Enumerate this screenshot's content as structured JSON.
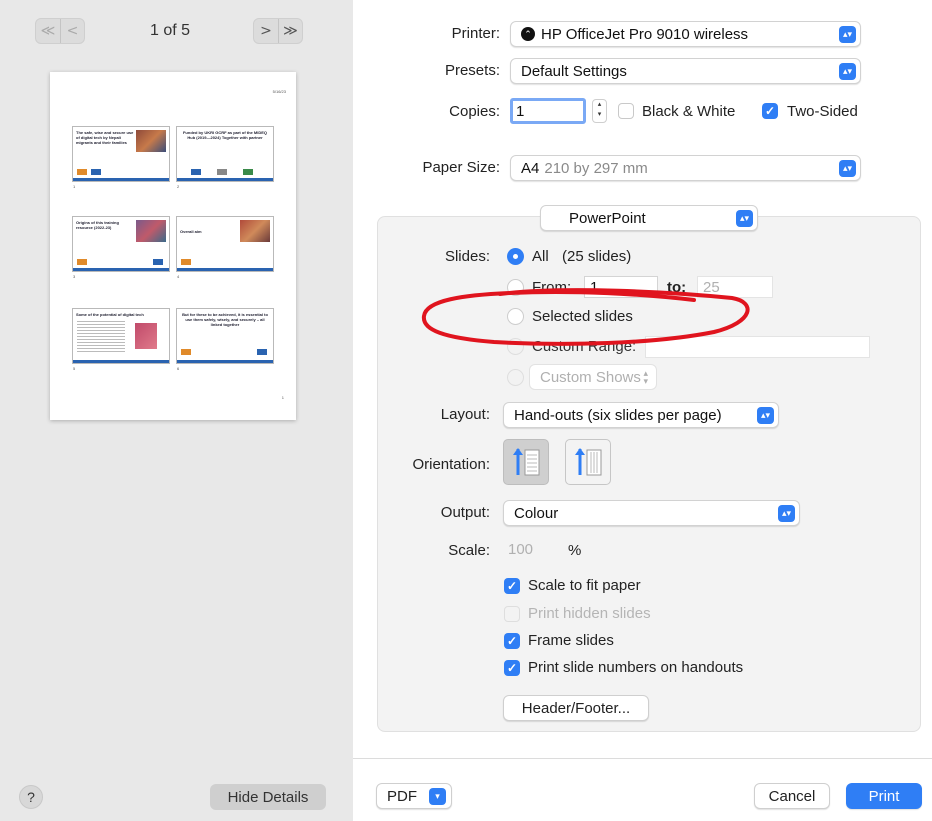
{
  "preview": {
    "page_indicator": "1 of 5",
    "nav_first_glyph": "≪",
    "nav_prev_glyph": "<",
    "nav_next_glyph": ">",
    "nav_last_glyph": "≫",
    "thumb_date": "5/16/23",
    "thumb_page_number": "1",
    "slides": [
      {
        "title": "The safe, wise and secure use of digital tech by Nepali migrants and their families",
        "number": "1"
      },
      {
        "title": "Funded by UKRI GCRF as part of the MIDEQ Hub (2019—2024) Together with partner",
        "number": "2"
      },
      {
        "title": "Origins of this training resource (2022-23)",
        "number": "3"
      },
      {
        "title": "Overall aim",
        "number": "4"
      },
      {
        "title": "Some of the potential of digital tech",
        "number": "5"
      },
      {
        "title": "But for these to be achieved, it is essential to use them safely, wisely, and securely – all linked together",
        "number": "6"
      }
    ]
  },
  "footer_left": {
    "help_label": "?",
    "hide_details_label": "Hide Details"
  },
  "printer": {
    "label": "Printer:",
    "value": "HP OfficeJet Pro 9010 wireless"
  },
  "presets": {
    "label": "Presets:",
    "value": "Default Settings"
  },
  "copies": {
    "label": "Copies:",
    "value": "1",
    "black_white_label": "Black & White",
    "black_white_checked": false,
    "two_sided_label": "Two-Sided",
    "two_sided_checked": true
  },
  "paper_size": {
    "label": "Paper Size:",
    "value": "A4",
    "detail": "210 by 297 mm"
  },
  "app_section": {
    "value": "PowerPoint"
  },
  "slides_option": {
    "label": "Slides:",
    "all_label": "All",
    "all_count": "(25 slides)",
    "from_label": "From:",
    "from_value": "1",
    "to_label": "to:",
    "to_value": "25",
    "selected_label": "Selected slides",
    "custom_range_label": "Custom Range:",
    "custom_shows_label": "Custom Shows"
  },
  "layout": {
    "label": "Layout:",
    "value": "Hand-outs (six slides per page)"
  },
  "orientation": {
    "label": "Orientation:"
  },
  "output": {
    "label": "Output:",
    "value": "Colour"
  },
  "scale": {
    "label": "Scale:",
    "value": "100",
    "unit": "%"
  },
  "options": [
    {
      "label": "Scale to fit paper",
      "checked": true,
      "enabled": true
    },
    {
      "label": "Print hidden slides",
      "checked": false,
      "enabled": false
    },
    {
      "label": "Frame slides",
      "checked": true,
      "enabled": true
    },
    {
      "label": "Print slide numbers on handouts",
      "checked": true,
      "enabled": true
    }
  ],
  "header_footer_label": "Header/Footer...",
  "bottom": {
    "pdf_label": "PDF",
    "cancel_label": "Cancel",
    "print_label": "Print"
  },
  "colors": {
    "accent": "#2f7ef5",
    "annotation": "#e0141e"
  },
  "icons": {
    "chevron": "updown-chevron-icon",
    "check": "checkmark-icon"
  }
}
